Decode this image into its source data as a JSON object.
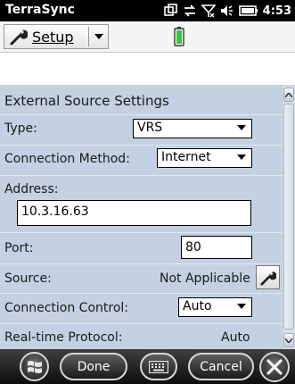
{
  "status_bar": {
    "app_title": "TerraSync",
    "time": "4:53",
    "icons": [
      "window-switch-icon",
      "data-sync-icon",
      "signal-off-icon",
      "volume-icon",
      "battery-icon"
    ]
  },
  "toolbar": {
    "section_label": "Setup",
    "section_icon": "wrench-icon",
    "status_icon": "gps-battery-icon"
  },
  "form": {
    "title": "External Source Settings",
    "type": {
      "label": "Type:",
      "value": "VRS"
    },
    "connection_method": {
      "label": "Connection Method:",
      "value": "Internet"
    },
    "address": {
      "label": "Address:",
      "value": "10.3.16.63"
    },
    "port": {
      "label": "Port:",
      "value": "80"
    },
    "source": {
      "label": "Source:",
      "value": "Not Applicable"
    },
    "connection_control": {
      "label": "Connection Control:",
      "value": "Auto"
    },
    "realtime_protocol": {
      "label": "Real-time Protocol:",
      "value": "Auto"
    }
  },
  "softkeys": {
    "done": "Done",
    "cancel": "Cancel"
  },
  "colors": {
    "panel_bg": "#c3d1e2",
    "bar_bg": "#000000"
  }
}
